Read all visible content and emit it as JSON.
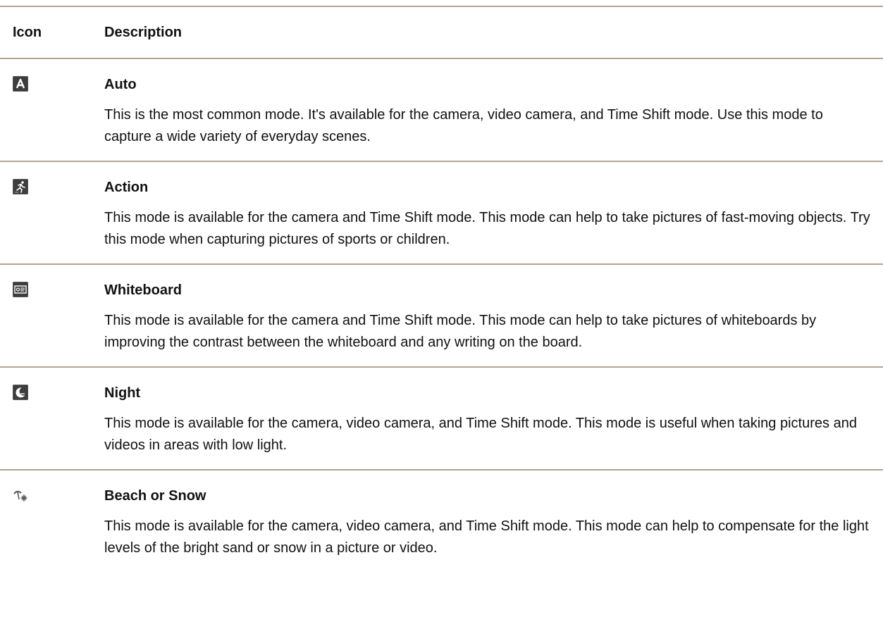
{
  "table": {
    "header": {
      "icon": "Icon",
      "description": "Description"
    },
    "rows": [
      {
        "icon": "auto-mode-icon",
        "title": "Auto",
        "text": "This is the most common mode. It's available for the camera, video camera, and Time Shift mode. Use this mode to capture a wide variety of everyday scenes."
      },
      {
        "icon": "action-mode-icon",
        "title": "Action",
        "text": "This mode is available for the camera and Time Shift mode. This mode can help to take pictures of fast-moving objects. Try this mode when capturing pictures of sports or children."
      },
      {
        "icon": "whiteboard-mode-icon",
        "title": "Whiteboard",
        "text": "This mode is available for the camera and Time Shift mode. This mode can help to take pictures of whiteboards by improving the contrast between the whiteboard and any writing on the board."
      },
      {
        "icon": "night-mode-icon",
        "title": "Night",
        "text": "This mode is available for the camera, video camera, and Time Shift mode. This mode is useful when taking pictures and videos in areas with low light."
      },
      {
        "icon": "beach-snow-mode-icon",
        "title": "Beach or Snow",
        "text": "This mode is available for the camera, video camera, and Time Shift mode. This mode can help to compensate for the light levels of the bright sand or snow in a picture or video."
      }
    ]
  },
  "colors": {
    "rule": "#b3a58b",
    "icon_bg": "#3d3d3d",
    "text": "#111111"
  }
}
